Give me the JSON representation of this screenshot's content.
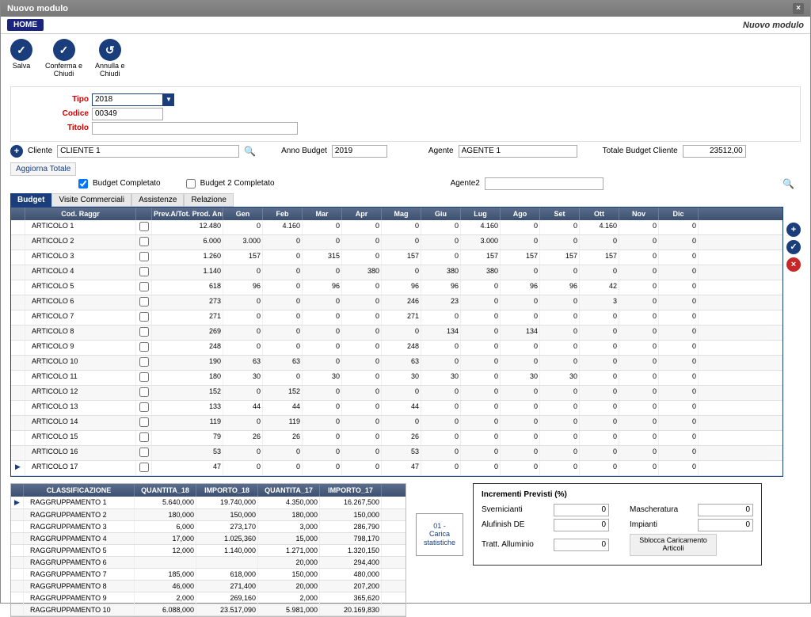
{
  "window": {
    "title": "Nuovo modulo",
    "breadcrumb": "Nuovo modulo"
  },
  "home_tab": "HOME",
  "toolbar": {
    "save": "Salva",
    "confirm_close": "Conferma e\nChiudi",
    "cancel_close": "Annulla e\nChiudi"
  },
  "form": {
    "tipo_label": "Tipo",
    "tipo_value": "2018",
    "codice_label": "Codice",
    "codice_value": "00349",
    "titolo_label": "Titolo",
    "titolo_value": ""
  },
  "filters": {
    "cliente_label": "Cliente",
    "cliente_value": "CLIENTE 1",
    "anno_label": "Anno Budget",
    "anno_value": "2019",
    "agente_label": "Agente",
    "agente_value": "AGENTE 1",
    "agente2_label": "Agente2",
    "agente2_value": "",
    "totale_label": "Totale Budget Cliente",
    "totale_value": "23512,00",
    "aggiorna_label": "Aggiorna Totale",
    "budget_completato": "Budget Completato",
    "budget2_completato": "Budget 2 Completato"
  },
  "tabs": [
    "Budget",
    "Visite Commerciali",
    "Assistenze",
    "Relazione"
  ],
  "grid": {
    "headers": [
      "",
      "Cod. Raggr",
      "",
      "Prev.A/Tot. Prod. Annu",
      "Gen",
      "Feb",
      "Mar",
      "Apr",
      "Mag",
      "Giu",
      "Lug",
      "Ago",
      "Set",
      "Ott",
      "Nov",
      "Dic"
    ],
    "rows": [
      {
        "m": "",
        "cod": "ARTICOLO 1",
        "tot": "12.480",
        "gen": "0",
        "feb": "4.160",
        "mar": "0",
        "apr": "0",
        "mag": "0",
        "giu": "0",
        "lug": "4.160",
        "ago": "0",
        "set": "0",
        "ott": "4.160",
        "nov": "0",
        "dic": "0"
      },
      {
        "m": "",
        "cod": "ARTICOLO 2",
        "tot": "6.000",
        "gen": "3.000",
        "feb": "0",
        "mar": "0",
        "apr": "0",
        "mag": "0",
        "giu": "0",
        "lug": "3.000",
        "ago": "0",
        "set": "0",
        "ott": "0",
        "nov": "0",
        "dic": "0"
      },
      {
        "m": "",
        "cod": "ARTICOLO 3",
        "tot": "1.260",
        "gen": "157",
        "feb": "0",
        "mar": "315",
        "apr": "0",
        "mag": "157",
        "giu": "0",
        "lug": "157",
        "ago": "157",
        "set": "157",
        "ott": "157",
        "nov": "0",
        "dic": "0"
      },
      {
        "m": "",
        "cod": "ARTICOLO 4",
        "tot": "1.140",
        "gen": "0",
        "feb": "0",
        "mar": "0",
        "apr": "380",
        "mag": "0",
        "giu": "380",
        "lug": "380",
        "ago": "0",
        "set": "0",
        "ott": "0",
        "nov": "0",
        "dic": "0"
      },
      {
        "m": "",
        "cod": "ARTICOLO 5",
        "tot": "618",
        "gen": "96",
        "feb": "0",
        "mar": "96",
        "apr": "0",
        "mag": "96",
        "giu": "96",
        "lug": "0",
        "ago": "96",
        "set": "96",
        "ott": "42",
        "nov": "0",
        "dic": "0"
      },
      {
        "m": "",
        "cod": "ARTICOLO 6",
        "tot": "273",
        "gen": "0",
        "feb": "0",
        "mar": "0",
        "apr": "0",
        "mag": "246",
        "giu": "23",
        "lug": "0",
        "ago": "0",
        "set": "0",
        "ott": "3",
        "nov": "0",
        "dic": "0"
      },
      {
        "m": "",
        "cod": "ARTICOLO 7",
        "tot": "271",
        "gen": "0",
        "feb": "0",
        "mar": "0",
        "apr": "0",
        "mag": "271",
        "giu": "0",
        "lug": "0",
        "ago": "0",
        "set": "0",
        "ott": "0",
        "nov": "0",
        "dic": "0"
      },
      {
        "m": "",
        "cod": "ARTICOLO 8",
        "tot": "269",
        "gen": "0",
        "feb": "0",
        "mar": "0",
        "apr": "0",
        "mag": "0",
        "giu": "134",
        "lug": "0",
        "ago": "134",
        "set": "0",
        "ott": "0",
        "nov": "0",
        "dic": "0"
      },
      {
        "m": "",
        "cod": "ARTICOLO 9",
        "tot": "248",
        "gen": "0",
        "feb": "0",
        "mar": "0",
        "apr": "0",
        "mag": "248",
        "giu": "0",
        "lug": "0",
        "ago": "0",
        "set": "0",
        "ott": "0",
        "nov": "0",
        "dic": "0"
      },
      {
        "m": "",
        "cod": "ARTICOLO 10",
        "tot": "190",
        "gen": "63",
        "feb": "63",
        "mar": "0",
        "apr": "0",
        "mag": "63",
        "giu": "0",
        "lug": "0",
        "ago": "0",
        "set": "0",
        "ott": "0",
        "nov": "0",
        "dic": "0"
      },
      {
        "m": "",
        "cod": "ARTICOLO 11",
        "tot": "180",
        "gen": "30",
        "feb": "0",
        "mar": "30",
        "apr": "0",
        "mag": "30",
        "giu": "30",
        "lug": "0",
        "ago": "30",
        "set": "30",
        "ott": "0",
        "nov": "0",
        "dic": "0"
      },
      {
        "m": "",
        "cod": "ARTICOLO 12",
        "tot": "152",
        "gen": "0",
        "feb": "152",
        "mar": "0",
        "apr": "0",
        "mag": "0",
        "giu": "0",
        "lug": "0",
        "ago": "0",
        "set": "0",
        "ott": "0",
        "nov": "0",
        "dic": "0"
      },
      {
        "m": "",
        "cod": "ARTICOLO 13",
        "tot": "133",
        "gen": "44",
        "feb": "44",
        "mar": "0",
        "apr": "0",
        "mag": "44",
        "giu": "0",
        "lug": "0",
        "ago": "0",
        "set": "0",
        "ott": "0",
        "nov": "0",
        "dic": "0"
      },
      {
        "m": "",
        "cod": "ARTICOLO 14",
        "tot": "119",
        "gen": "0",
        "feb": "119",
        "mar": "0",
        "apr": "0",
        "mag": "0",
        "giu": "0",
        "lug": "0",
        "ago": "0",
        "set": "0",
        "ott": "0",
        "nov": "0",
        "dic": "0"
      },
      {
        "m": "",
        "cod": "ARTICOLO 15",
        "tot": "79",
        "gen": "26",
        "feb": "26",
        "mar": "0",
        "apr": "0",
        "mag": "26",
        "giu": "0",
        "lug": "0",
        "ago": "0",
        "set": "0",
        "ott": "0",
        "nov": "0",
        "dic": "0"
      },
      {
        "m": "",
        "cod": "ARTICOLO 16",
        "tot": "53",
        "gen": "0",
        "feb": "0",
        "mar": "0",
        "apr": "0",
        "mag": "53",
        "giu": "0",
        "lug": "0",
        "ago": "0",
        "set": "0",
        "ott": "0",
        "nov": "0",
        "dic": "0"
      },
      {
        "m": "▶",
        "cod": "ARTICOLO 17",
        "tot": "47",
        "gen": "0",
        "feb": "0",
        "mar": "0",
        "apr": "0",
        "mag": "47",
        "giu": "0",
        "lug": "0",
        "ago": "0",
        "set": "0",
        "ott": "0",
        "nov": "0",
        "dic": "0"
      }
    ]
  },
  "grid2": {
    "headers": [
      "",
      "CLASSIFICAZIONE",
      "QUANTITA_18",
      "IMPORTO_18",
      "QUANTITA_17",
      "IMPORTO_17"
    ],
    "rows": [
      {
        "m": "▶",
        "cls": "RAGGRUPPAMENTO 1",
        "q18": "5.640,000",
        "i18": "19.740,000",
        "q17": "4.350,000",
        "i17": "16.267,500"
      },
      {
        "m": "",
        "cls": "RAGGRUPPAMENTO 2",
        "q18": "180,000",
        "i18": "150,000",
        "q17": "180,000",
        "i17": "150,000"
      },
      {
        "m": "",
        "cls": "RAGGRUPPAMENTO 3",
        "q18": "6,000",
        "i18": "273,170",
        "q17": "3,000",
        "i17": "286,790"
      },
      {
        "m": "",
        "cls": "RAGGRUPPAMENTO 4",
        "q18": "17,000",
        "i18": "1.025,360",
        "q17": "15,000",
        "i17": "798,170"
      },
      {
        "m": "",
        "cls": "RAGGRUPPAMENTO 5",
        "q18": "12,000",
        "i18": "1.140,000",
        "q17": "1.271,000",
        "i17": "1.320,150"
      },
      {
        "m": "",
        "cls": "RAGGRUPPAMENTO 6",
        "q18": "",
        "i18": "",
        "q17": "20,000",
        "i17": "294,400"
      },
      {
        "m": "",
        "cls": "RAGGRUPPAMENTO 7",
        "q18": "185,000",
        "i18": "618,000",
        "q17": "150,000",
        "i17": "480,000"
      },
      {
        "m": "",
        "cls": "RAGGRUPPAMENTO 8",
        "q18": "46,000",
        "i18": "271,400",
        "q17": "20,000",
        "i17": "207,200"
      },
      {
        "m": "",
        "cls": "RAGGRUPPAMENTO 9",
        "q18": "2,000",
        "i18": "269,160",
        "q17": "2,000",
        "i17": "365,620"
      },
      {
        "m": "",
        "cls": "RAGGRUPPAMENTO 10",
        "q18": "6.088,000",
        "i18": "23.517,090",
        "q17": "5.981,000",
        "i17": "20.169,830"
      }
    ]
  },
  "center_button": "01 - Carica statistiche",
  "incrementi": {
    "title": "Incrementi Previsti (%)",
    "svernicianti_label": "Svernicianti",
    "svernicianti": "0",
    "mascheratura_label": "Mascheratura",
    "mascheratura": "0",
    "alufinish_label": "Alufinish DE",
    "alufinish": "0",
    "impianti_label": "Impianti",
    "impianti": "0",
    "tratt_label": "Tratt. Alluminio",
    "tratt": "0",
    "unlock": "Sblocca Caricamento Articoli"
  }
}
